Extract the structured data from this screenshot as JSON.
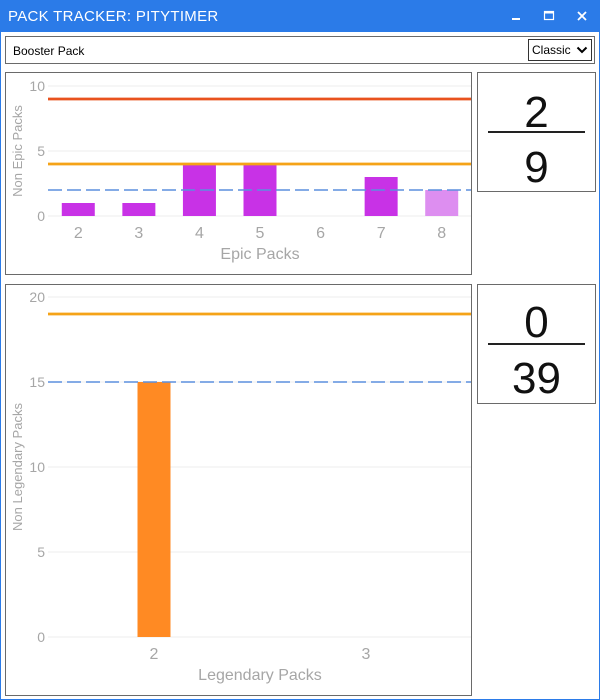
{
  "window": {
    "title": "PACK TRACKER: PITYTIMER"
  },
  "toolbar": {
    "pack_label": "Booster Pack",
    "set_select": "Classic"
  },
  "colors": {
    "titlebar": "#2b7be8",
    "epic_bar": "#c832e6",
    "epic_bar_current": "#dd8ef0",
    "legendary_bar": "#ff8a23",
    "max_line_epic": "#e9521e",
    "orange_line": "#f5a317",
    "average_line": "#5b8fde"
  },
  "counters": {
    "epic": {
      "current": "2",
      "limit": "9"
    },
    "legendary": {
      "current": "0",
      "limit": "39"
    }
  },
  "chart_data": [
    {
      "type": "bar",
      "categories": [
        "2",
        "3",
        "4",
        "5",
        "6",
        "7",
        "8"
      ],
      "values": [
        1,
        1,
        4,
        4,
        0,
        3,
        2
      ],
      "highlight_index": 6,
      "xlabel": "Epic Packs",
      "ylabel": "Non Epic Packs",
      "ylim": [
        0,
        10
      ],
      "yticks": [
        0,
        5,
        10
      ],
      "reference_lines": [
        {
          "value": 9,
          "style": "solid",
          "color": "#e9521e"
        },
        {
          "value": 4,
          "style": "solid",
          "color": "#f5a317"
        },
        {
          "value": 2,
          "style": "dashed",
          "color": "#5b8fde"
        }
      ],
      "grid": true
    },
    {
      "type": "bar",
      "categories": [
        "2",
        "3"
      ],
      "values": [
        15,
        0
      ],
      "xlabel": "Legendary Packs",
      "ylabel": "Non Legendary Packs",
      "ylim": [
        0,
        20
      ],
      "yticks": [
        0,
        5,
        10,
        15,
        20
      ],
      "reference_lines": [
        {
          "value": 19,
          "style": "solid",
          "color": "#f5a317"
        },
        {
          "value": 15,
          "style": "dashed",
          "color": "#5b8fde"
        }
      ],
      "grid": true
    }
  ]
}
